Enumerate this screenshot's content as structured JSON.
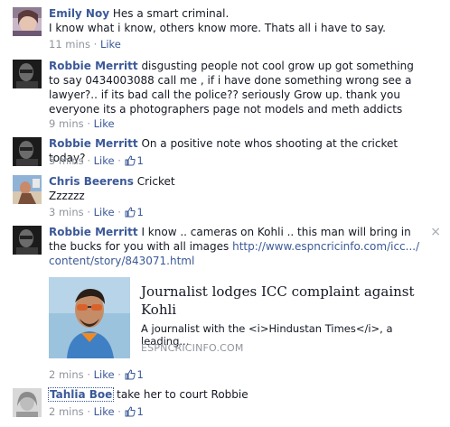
{
  "comments": [
    {
      "author": "Emily Noy",
      "text": "Hes a smart criminal.",
      "text2": "I know what i know, others know more. Thats all i have to say.",
      "time": "11 mins",
      "like": "Like"
    },
    {
      "author": "Robbie Merritt",
      "text": "disgusting people not cool grow up got something to say 0434003088 call me , if i have done something wrong see a lawyer?.. if its bad call the police?? seriously Grow up. thank you everyone its a photographers page not models and meth addicts",
      "time": "9 mins",
      "like": "Like"
    },
    {
      "author": "Robbie Merritt",
      "text": "On a positive note whos shooting at the cricket today?",
      "time": "5 mins",
      "like": "Like",
      "likes": "1"
    },
    {
      "author": "Chris Beerens",
      "text": "Cricket",
      "text2": "Zzzzzz",
      "time": "3 mins",
      "like": "Like",
      "likes": "1"
    },
    {
      "author": "Robbie Merritt",
      "text": "I know .. cameras on Kohli .. this man will bring in the bucks for you with all images",
      "link": "http://www.espncricinfo.com/icc.../content/story/843071.html",
      "time": "2 mins",
      "like": "Like",
      "likes": "1",
      "close": "×",
      "preview": {
        "title": "Journalist lodges ICC complaint against Kohli",
        "desc": "A journalist with the <i>Hindustan Times</i>, a leading...",
        "source": "ESPNCRICINFO.COM"
      }
    },
    {
      "author": "Tahlia Boe",
      "text": "take her to court Robbie",
      "time": "2 mins",
      "like": "Like",
      "likes": "1"
    }
  ],
  "separator": "·",
  "icons": {
    "thumb": "thumbs-up-icon",
    "close": "close-icon"
  },
  "colors": {
    "link": "#3b5998",
    "meta": "#90949c",
    "text": "#141823"
  }
}
